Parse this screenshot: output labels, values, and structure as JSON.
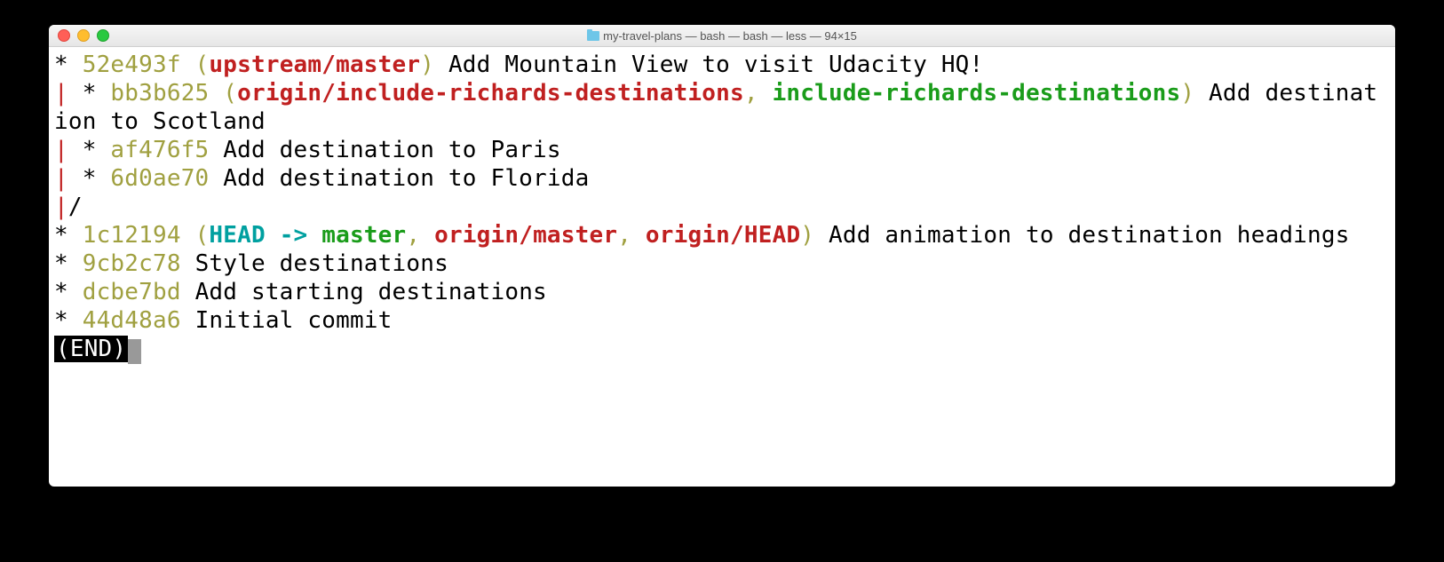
{
  "window": {
    "title": "my-travel-plans — bash — bash — less — 94×15"
  },
  "commits": {
    "c1": {
      "hash": "52e493f",
      "ref": "upstream/master",
      "msg": "Add Mountain View to visit Udacity HQ!"
    },
    "c2": {
      "hash": "bb3b625",
      "ref_remote": "origin/include-richards-destinations",
      "ref_local": "include-richards-destinations",
      "msg": "Add destination to Scotland"
    },
    "c3": {
      "hash": "af476f5",
      "msg": "Add destination to Paris"
    },
    "c4": {
      "hash": "6d0ae70",
      "msg": "Add destination to Florida"
    },
    "c5": {
      "hash": "1c12194",
      "head": "HEAD -> ",
      "local": "master",
      "remote1": "origin/master",
      "remote2": "origin/HEAD",
      "msg": "Add animation to destination headings"
    },
    "c6": {
      "hash": "9cb2c78",
      "msg": "Style destinations"
    },
    "c7": {
      "hash": "dcbe7bd",
      "msg": "Add starting destinations"
    },
    "c8": {
      "hash": "44d48a6",
      "msg": "Initial commit"
    }
  },
  "pager": {
    "end": "(END)"
  },
  "sep": {
    "comma": ", ",
    "open": "(",
    "close": ")"
  }
}
